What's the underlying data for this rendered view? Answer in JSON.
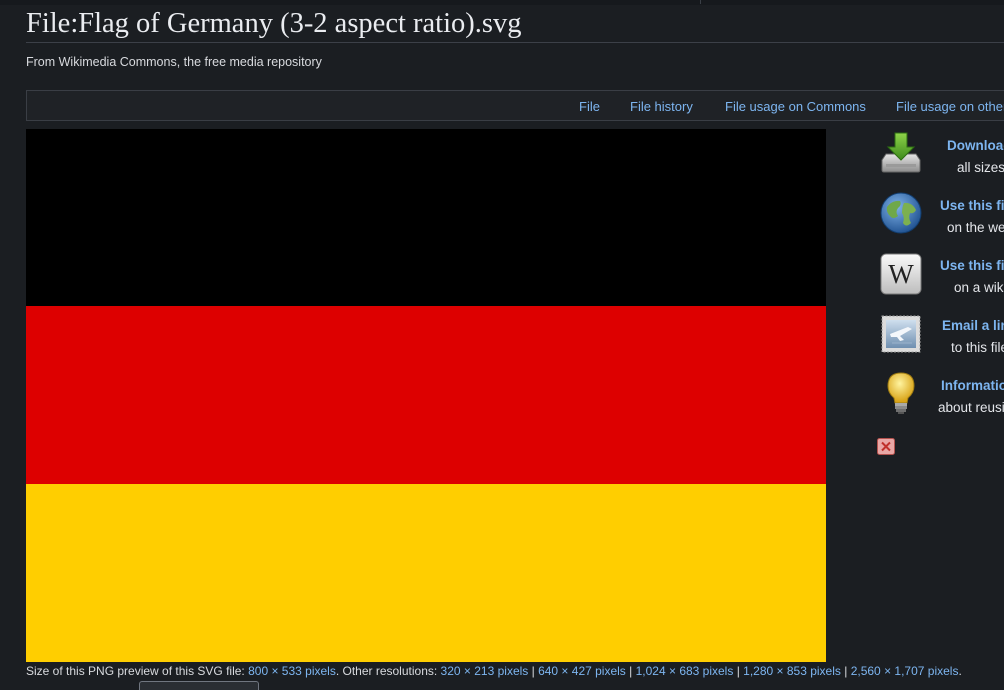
{
  "page": {
    "title": "File:Flag of Germany (3-2 aspect ratio).svg",
    "subtitle": "From Wikimedia Commons, the free media repository"
  },
  "tabs": [
    {
      "label": "File"
    },
    {
      "label": "File history"
    },
    {
      "label": "File usage on Commons"
    },
    {
      "label": "File usage on other wikis"
    }
  ],
  "flag": {
    "colors": [
      "#000000",
      "#dd0000",
      "#ffce00"
    ]
  },
  "sidebar": {
    "items": [
      {
        "icon": "download-icon",
        "link": "Download",
        "desc": "all sizes"
      },
      {
        "icon": "globe-icon",
        "link": "Use this file",
        "desc": "on the web"
      },
      {
        "icon": "wikipedia-icon",
        "link": "Use this file",
        "desc": "on a wiki"
      },
      {
        "icon": "email-stamp-icon",
        "link": "Email a link",
        "desc": "to this file"
      },
      {
        "icon": "lightbulb-icon",
        "link": "Information",
        "desc": "about reusing"
      }
    ],
    "close_icon": "close-icon"
  },
  "size_line": {
    "prefix": "Size of this PNG preview of this SVG file: ",
    "preview": "800 × 533 pixels",
    "other_label": ". Other resolutions: ",
    "resolutions": [
      "320 × 213 pixels",
      "640 × 427 pixels",
      "1,024 × 683 pixels",
      "1,280 × 853 pixels",
      "2,560 × 1,707 pixels"
    ],
    "separator": " | ",
    "suffix": "."
  }
}
